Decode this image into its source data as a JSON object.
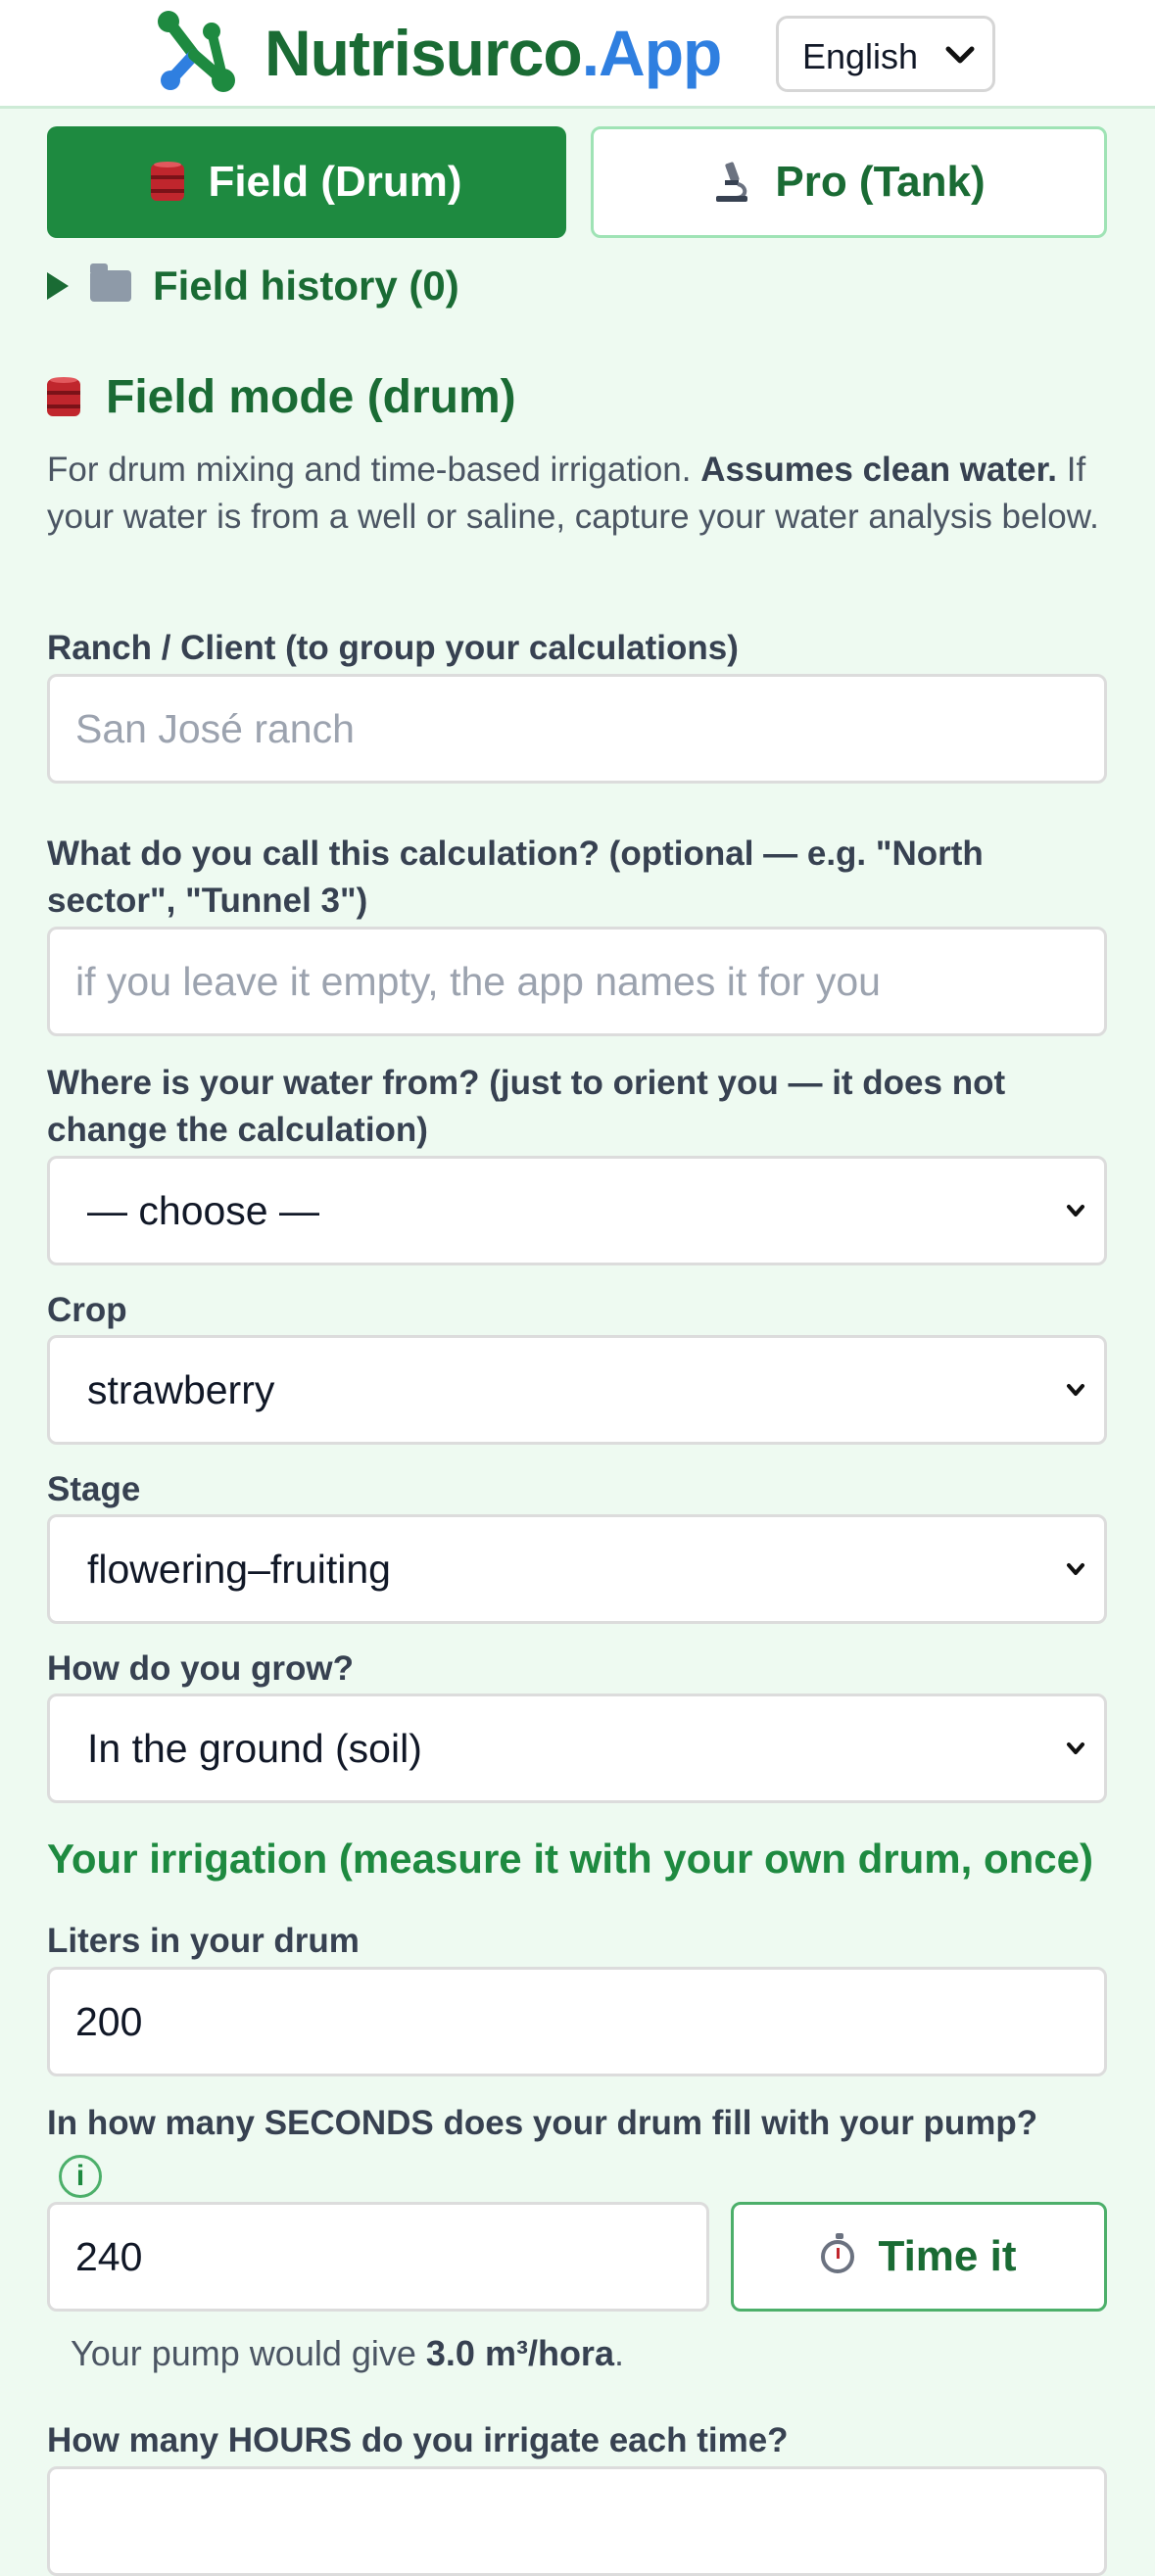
{
  "header": {
    "brand_part1": "Nutrisurco",
    "brand_part2": ".App",
    "language_selected": "English",
    "logo_icon": "network-nodes-icon",
    "brand_colors": {
      "green": "#1a6b34",
      "blue": "#2f7fe0"
    }
  },
  "modes": {
    "field_label": "Field (Drum)",
    "pro_label": "Pro (Tank)",
    "active": "field"
  },
  "history": {
    "label": "Field history (0)"
  },
  "section": {
    "title": "Field mode (drum)",
    "desc_prefix": "For drum mixing and time-based irrigation. ",
    "desc_bold": "Assumes clean water.",
    "desc_suffix": " If your water is from a well or saline, capture your water analysis below."
  },
  "form": {
    "ranch_label": "Ranch / Client (to group your calculations)",
    "ranch_placeholder": "San José ranch",
    "calc_name_label": "What do you call this calculation? (optional — e.g. \"North sector\", \"Tunnel 3\")",
    "calc_name_placeholder": "if you leave it empty, the app names it for you",
    "water_source_label": "Where is your water from? (just to orient you — it does not change the calculation)",
    "water_source_value": "— choose —",
    "crop_label": "Crop",
    "crop_value": "strawberry",
    "stage_label": "Stage",
    "stage_value": "flowering–fruiting",
    "grow_label": "How do you grow?",
    "grow_value": "In the ground (soil)"
  },
  "irrigation": {
    "heading": "Your irrigation (measure it with your own drum, once)",
    "liters_label": "Liters in your drum",
    "liters_value": "200",
    "seconds_label": "In how many SECONDS does your drum fill with your pump?",
    "info_glyph": "i",
    "seconds_value": "240",
    "time_button": "Time it",
    "flow_prefix": "Your pump would give ",
    "flow_value": "3.0 m³/hora",
    "flow_suffix": ".",
    "hours_label": "How many HOURS do you irrigate each time?"
  }
}
